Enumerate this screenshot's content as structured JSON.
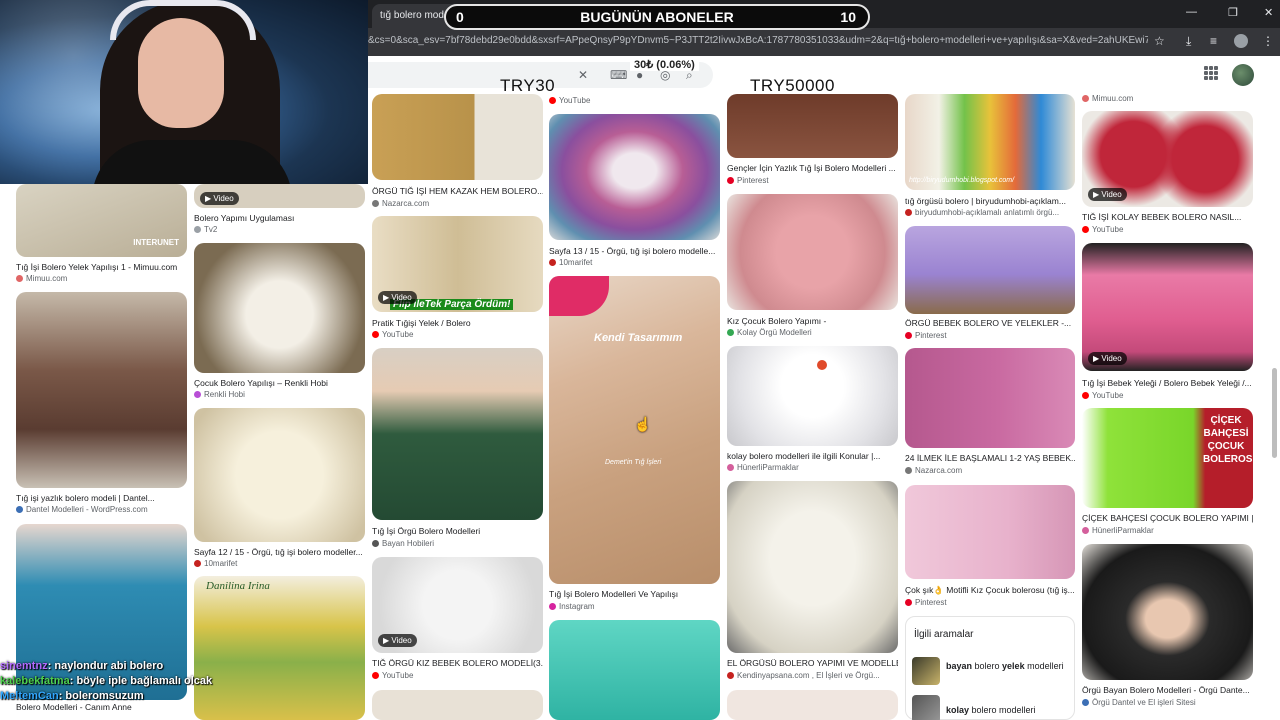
{
  "browser": {
    "tab_title": "tığ bolero modelleri ve yapılışı",
    "tab_close": "×",
    "new_tab": "+",
    "url": "&cs=0&sca_esv=7bf78debd29e0bdd&sxsrf=APpeQnsyP9pYDnvm5~P3JTT2t2IivwJxBcA:1787780351033&udm=2&q=tığ+bolero+modelleri+ve+yapılışı&sa=X&ved=2ahUKEwi7uljmoL-WA...",
    "min": "—",
    "max": "❐",
    "close": "✕"
  },
  "overlay": {
    "banner_left": "0",
    "banner_title": "BUGÜNÜN ABONELER",
    "banner_right": "10",
    "donation": "30₺ (0.06%)",
    "coupon_left": "TRY30",
    "coupon_right": "TRY50000"
  },
  "chat": [
    {
      "user": "sinemtnz",
      "msg": ": naylondur abi bolero"
    },
    {
      "user": "kalebekfatma",
      "msg": ": böyle iple bağlamalı olcak"
    },
    {
      "user": "MeltemCan",
      "msg": ": boleromsuzum"
    }
  ],
  "video_label": "Video",
  "cards": {
    "c1": {
      "title": "Tığ İşi Bolero Yelek Yapılışı 1 - Mimuu.com",
      "src": "Mimuu.com"
    },
    "c2": {
      "title": "Tığ işi yazlık bolero modeli | Dantel...",
      "src": "Dantel Modelleri - WordPress.com"
    },
    "c3": {
      "title": "Bolero Modelleri - Canım Anne",
      "src": "Canım Anne"
    },
    "c4": {
      "title": "Bolero Yapımı Uygulaması",
      "src": "Tv2"
    },
    "c5": {
      "title": "Çocuk Bolero Yapılışı – Renkli Hobi",
      "src": "Renkli Hobi"
    },
    "c6": {
      "title": "Sayfa 12 / 15 - Örgü, tığ işi bolero modeller...",
      "src": "10marifet"
    },
    "c7": {
      "title": "ÖRGÜ TIĞ İŞİ HEM KAZAK HEM BOLERO...",
      "src": "Nazarca.com"
    },
    "c8": {
      "title": "Pratik Tığişi Yelek / Bolero",
      "src": "YouTube"
    },
    "c9": {
      "title": "Tığ İşi Örgü Bolero Modelleri",
      "src": "Bayan Hobileri"
    },
    "c10": {
      "title": "TIĞ ÖRGÜ KIZ BEBEK BOLERO MODELİ(3...",
      "src": "YouTube"
    },
    "c11": {
      "title": "Sayfa 13 / 15 - Örgü, tığ işi bolero modelle...",
      "src": "10marifet"
    },
    "c12": {
      "title": "Tığ İşi Bolero Modelleri Ve Yapılışı",
      "src": "Instagram"
    },
    "c13": {
      "title": "Gençler İçin Yazlık Tığ İşi Bolero Modelleri ...",
      "src": "Pinterest"
    },
    "c14": {
      "title": "Kız Çocuk Bolero Yapımı -",
      "src": "Kolay Örgü Modelleri"
    },
    "c15": {
      "title": "kolay bolero modelleri ile ilgili Konular |...",
      "src": "HünerliParmaklar"
    },
    "c16": {
      "title": "EL ÖRGÜSÜ BOLERO YAPIMI VE MODELLE...",
      "src": "Kendinyapsana.com , El İşleri ve Örgü..."
    },
    "c17": {
      "title": "tığ örgüsü bolero | biryudumhobi-açıklam...",
      "src": "biryudumhobi-açıklamalı anlatımlı örgü..."
    },
    "c18": {
      "title": "ÖRGÜ BEBEK BOLERO VE YELEKLER -...",
      "src": "Pinterest"
    },
    "c19": {
      "title": "24 İLMEK İLE BAŞLAMALI 1-2 YAŞ BEBEK...",
      "src": "Nazarca.com"
    },
    "c20": {
      "title": "Çok şık👌 Motifli Kız Çocuk bolerosu (tığ iş...",
      "src": "Pinterest"
    },
    "c21": {
      "title": "TIĞ İŞİ KOLAY BEBEK BOLERO NASIL...",
      "src": "YouTube"
    },
    "c22": {
      "title": "Tığ İşi Bebek Yeleği / Bolero Bebek Yeleği /...",
      "src": "YouTube"
    },
    "c23": {
      "title": "ÇİÇEK BAHÇESİ ÇOCUK BOLERO YAPIMI |...",
      "src": "HünerliParmaklar"
    },
    "c24": {
      "title": "Örgü Bayan Bolero Modelleri - Örgü Dante...",
      "src": "Örgü Dantel ve El işleri Sitesi"
    }
  },
  "top_sources": {
    "t1": "YouTube",
    "t2": "Mimuu.com"
  },
  "thumb_text": {
    "kendi": "Kendi Tasarımım",
    "demet": "Demet'in Tığ İşleri",
    "flip": "Flip ileTek Parça Ördüm!",
    "blog": "http://biryudumhobi.blogspot.com/",
    "cicek": [
      "ÇİÇEK",
      "BAHÇESİ",
      "ÇOCUK",
      "BOLEROSU"
    ],
    "danilina": "Danilina Irina",
    "internet": "INTERUNET"
  },
  "related": {
    "heading": "İlgili aramalar",
    "items": [
      {
        "bold1": "bayan",
        "mid": " bolero ",
        "bold2": "yelek",
        "rest": " modelleri"
      },
      {
        "bold1": "kolay",
        "mid": " bolero modelleri",
        "bold2": "",
        "rest": ""
      }
    ]
  },
  "colors": {
    "chrome_dark": "#202124",
    "chrome_mid": "#35363a",
    "accent_red": "#c5221f"
  }
}
